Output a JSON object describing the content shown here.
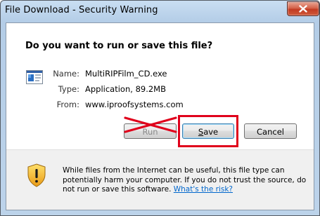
{
  "window": {
    "title": "File Download - Security Warning",
    "close_label": "X"
  },
  "dialog": {
    "question": "Do you want to run or save this file?",
    "fields": {
      "name_label": "Name:",
      "name_value": "MultiRIPFilm_CD.exe",
      "type_label": "Type:",
      "type_value": "Application, 89.2MB",
      "from_label": "From:",
      "from_value": "www.iproofsystems.com"
    },
    "buttons": {
      "run_label": "Run",
      "save_label": "Save",
      "save_accesskey_char": "S",
      "save_rest": "ave",
      "cancel_label": "Cancel"
    },
    "warning": {
      "text": "While files from the Internet can be useful, this file type can potentially harm your computer. If you do not trust the source, do not run or save this software.",
      "link_text": "What's the risk?"
    }
  },
  "annotations": {
    "highlight_color": "#e0001b",
    "cross_color": "#e0001b"
  },
  "icons": {
    "app": "application-icon",
    "shield": "security-shield-warning-icon"
  }
}
